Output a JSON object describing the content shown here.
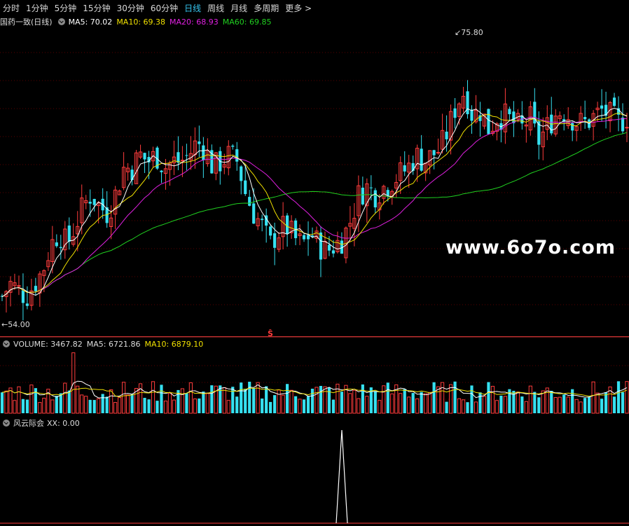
{
  "tabs": [
    "分时",
    "1分钟",
    "5分钟",
    "15分钟",
    "30分钟",
    "60分钟",
    "日线",
    "周线",
    "月线",
    "多周期",
    "更多 >"
  ],
  "active_tab": "日线",
  "main_info": {
    "title": "国药一致(日线)",
    "ma5": "MA5: 70.02",
    "ma10": "MA10: 69.38",
    "ma20": "MA20: 68.93",
    "ma60": "MA60: 69.85"
  },
  "high_label": "75.80",
  "low_label": "54.00",
  "event_marker": "Ŝ",
  "volume_info": {
    "title": "VOLUME: 3467.82",
    "ma5": "MA5: 6721.86",
    "ma10": "MA10: 6879.10"
  },
  "indicator_info": {
    "title": "风云际会",
    "xx": "XX: 0.00"
  },
  "watermark": "www.6o7o.com",
  "colors": {
    "up": "#ff3c3c",
    "down": "#36e0f0",
    "ma5": "#ffffff",
    "ma10": "#f0e000",
    "ma20": "#e020e0",
    "ma60": "#20d020",
    "grid": "#5a0000"
  },
  "chart_data": {
    "type": "candlestick",
    "price_range": [
      54.0,
      75.8
    ],
    "close_trend": [
      56,
      57,
      56.5,
      56,
      57,
      58,
      60,
      61,
      60,
      61.5,
      63,
      64,
      63,
      62.5,
      64,
      66,
      66,
      67,
      66.5,
      67,
      66,
      66.5,
      66.5,
      67,
      68,
      67.5,
      66,
      66.5,
      67,
      66.5,
      64,
      62.5,
      61.5,
      60,
      61,
      61.5,
      60.5,
      60,
      61,
      60,
      59.5,
      60,
      60.5,
      62,
      64,
      64.5,
      64,
      64.5,
      65,
      65.5,
      66,
      67,
      66.5,
      67,
      67.5,
      69,
      71,
      72,
      70,
      70.5,
      69,
      70,
      70,
      69.5,
      69,
      70,
      68,
      69,
      70,
      70.5,
      70,
      69.5,
      69.5,
      70,
      70.5,
      70,
      69.5,
      70
    ],
    "volume_range": [
      0,
      15000
    ],
    "indicator_xx": 0.0
  }
}
